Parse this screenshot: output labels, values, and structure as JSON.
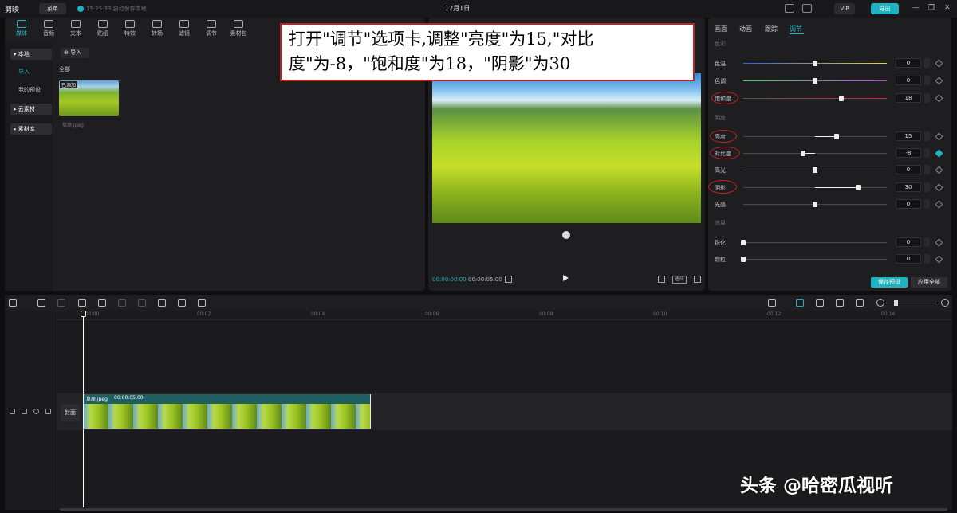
{
  "topbar": {
    "logo": "剪映",
    "menu_label": "菜单",
    "autosave": "15:25:33 自动保存本地",
    "project_name": "12月1日",
    "vip_label": "VIP",
    "export_label": "导出"
  },
  "toolbar": {
    "items": [
      {
        "label": "媒体",
        "icon": "media-icon"
      },
      {
        "label": "音频",
        "icon": "audio-icon"
      },
      {
        "label": "文本",
        "icon": "text-icon"
      },
      {
        "label": "贴纸",
        "icon": "sticker-icon"
      },
      {
        "label": "特效",
        "icon": "effects-icon"
      },
      {
        "label": "转场",
        "icon": "transition-icon"
      },
      {
        "label": "滤镜",
        "icon": "filter-icon"
      },
      {
        "label": "调节",
        "icon": "adjust-icon"
      },
      {
        "label": "素材包",
        "icon": "package-icon"
      }
    ]
  },
  "sidebar": {
    "items": [
      "本地",
      "导入",
      "我的预设",
      "云素材",
      "素材库"
    ]
  },
  "media": {
    "import_label": "导入",
    "all_label": "全部",
    "added_badge": "已添加",
    "file_name": "草原.jpeg"
  },
  "player": {
    "current_time": "00:00:00:00",
    "total_time": "00:00:05:00",
    "ratio_label": "适应"
  },
  "callout": {
    "line1": "打开\"调节\"选项卡,调整\"亮度\"为15,\"对比",
    "line2": "度\"为-8，\"饱和度\"为18，\"阴影\"为30"
  },
  "adjust": {
    "tabs": [
      "画面",
      "动画",
      "跟踪",
      "调节"
    ],
    "active_tab": "调节",
    "section_color": "色彩",
    "section_light": "明度",
    "section_effect": "效果",
    "rows": [
      {
        "label": "色温",
        "value": "0"
      },
      {
        "label": "色调",
        "value": "0"
      },
      {
        "label": "饱和度",
        "value": "18"
      },
      {
        "label": "亮度",
        "value": "15"
      },
      {
        "label": "对比度",
        "value": "-8"
      },
      {
        "label": "高光",
        "value": "0"
      },
      {
        "label": "阴影",
        "value": "30"
      },
      {
        "label": "光感",
        "value": "0"
      },
      {
        "label": "锐化",
        "value": "0"
      },
      {
        "label": "颗粒",
        "value": "0"
      }
    ],
    "save_preset": "保存预设",
    "apply_all": "应用全部"
  },
  "timeline": {
    "ticks": [
      "00:00",
      "00:02",
      "00:04",
      "00:06",
      "00:08",
      "00:10",
      "00:12",
      "00:14"
    ],
    "cover_label": "封面",
    "clip_name": "草原.jpeg",
    "clip_duration": "00:00:05:00"
  },
  "watermark": "头条 @哈密瓜视听",
  "colors": {
    "accent": "#20b2c0",
    "annotation": "#c81e1e"
  }
}
